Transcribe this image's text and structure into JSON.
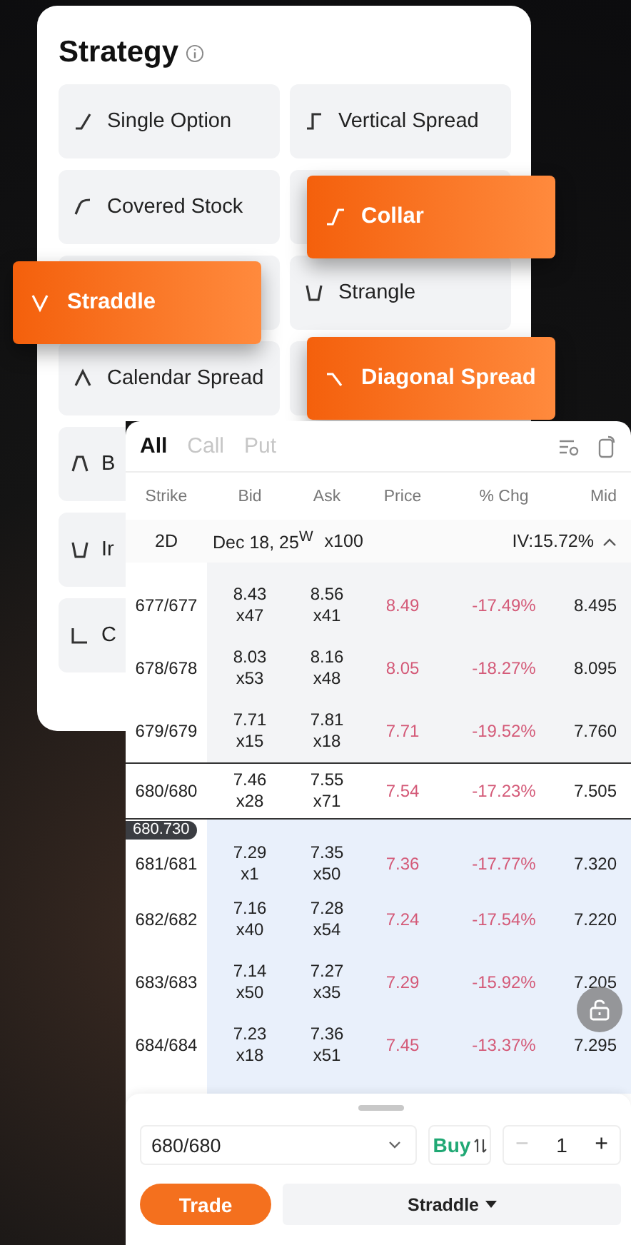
{
  "strategy": {
    "title": "Strategy",
    "items": [
      {
        "label": "Single Option",
        "kind": "tile"
      },
      {
        "label": "Vertical Spread",
        "kind": "tile"
      },
      {
        "label": "Covered Stock",
        "kind": "tile"
      },
      {
        "label": "Collar",
        "kind": "floating"
      },
      {
        "label": "Straddle",
        "kind": "floating"
      },
      {
        "label": "Strangle",
        "kind": "tile"
      },
      {
        "label": "Calendar Spread",
        "kind": "tile"
      },
      {
        "label": "Diagonal Spread",
        "kind": "floating"
      },
      {
        "label": "B",
        "kind": "partial"
      },
      {
        "label": "Ir",
        "kind": "partial"
      },
      {
        "label": "C",
        "kind": "partial"
      }
    ]
  },
  "chain": {
    "tabs": [
      {
        "label": "All",
        "selected": true
      },
      {
        "label": "Call",
        "selected": false
      },
      {
        "label": "Put",
        "selected": false
      }
    ],
    "columns": [
      "Strike",
      "Bid",
      "Ask",
      "Price",
      "% Chg",
      "Mid"
    ],
    "expiry": {
      "days": "2D",
      "date": "Dec 18, 25$^{W}$",
      "multiplier": "x100",
      "iv": "IV:15.72%",
      "expanded": true
    },
    "rows": [
      {
        "strike": "677/677",
        "bid": "8.43",
        "bid_size": "x47",
        "ask": "8.56",
        "ask_size": "x41",
        "price": "8.49",
        "change": "-17.49%",
        "mid": "8.495",
        "kind": "upper",
        "selected": false
      },
      {
        "strike": "678/678",
        "bid": "8.03",
        "bid_size": "x53",
        "ask": "8.16",
        "ask_size": "x48",
        "price": "8.05",
        "change": "-18.27%",
        "mid": "8.095",
        "kind": "upper",
        "selected": false
      },
      {
        "strike": "679/679",
        "bid": "7.71",
        "bid_size": "x15",
        "ask": "7.81",
        "ask_size": "x18",
        "price": "7.71",
        "change": "-19.52%",
        "mid": "7.760",
        "kind": "upper",
        "selected": false
      },
      {
        "strike": "680/680",
        "bid": "7.46",
        "bid_size": "x28",
        "ask": "7.55",
        "ask_size": "x71",
        "price": "7.54",
        "change": "-17.23%",
        "mid": "7.505",
        "kind": "upper",
        "selected": true,
        "underlying": "680.730"
      },
      {
        "strike": "681/681",
        "bid": "7.29",
        "bid_size": "x1",
        "ask": "7.35",
        "ask_size": "x50",
        "price": "7.36",
        "change": "-17.77%",
        "mid": "7.320",
        "kind": "lower",
        "selected": false
      },
      {
        "strike": "682/682",
        "bid": "7.16",
        "bid_size": "x40",
        "ask": "7.28",
        "ask_size": "x54",
        "price": "7.24",
        "change": "-17.54%",
        "mid": "7.220",
        "kind": "lower",
        "selected": false
      },
      {
        "strike": "683/683",
        "bid": "7.14",
        "bid_size": "x50",
        "ask": "7.27",
        "ask_size": "x35",
        "price": "7.29",
        "change": "-15.92%",
        "mid": "7.205",
        "kind": "lower",
        "selected": false
      },
      {
        "strike": "684/684",
        "bid": "7.23",
        "bid_size": "x18",
        "ask": "7.36",
        "ask_size": "x51",
        "price": "7.45",
        "change": "-13.37%",
        "mid": "7.295",
        "kind": "lower",
        "selected": false
      }
    ]
  },
  "order": {
    "contract": "680/680",
    "side": "Buy",
    "decrement": "−",
    "quantity": "1",
    "increment": "+",
    "trade_button": "Trade",
    "strategy_button": "Straddle"
  }
}
